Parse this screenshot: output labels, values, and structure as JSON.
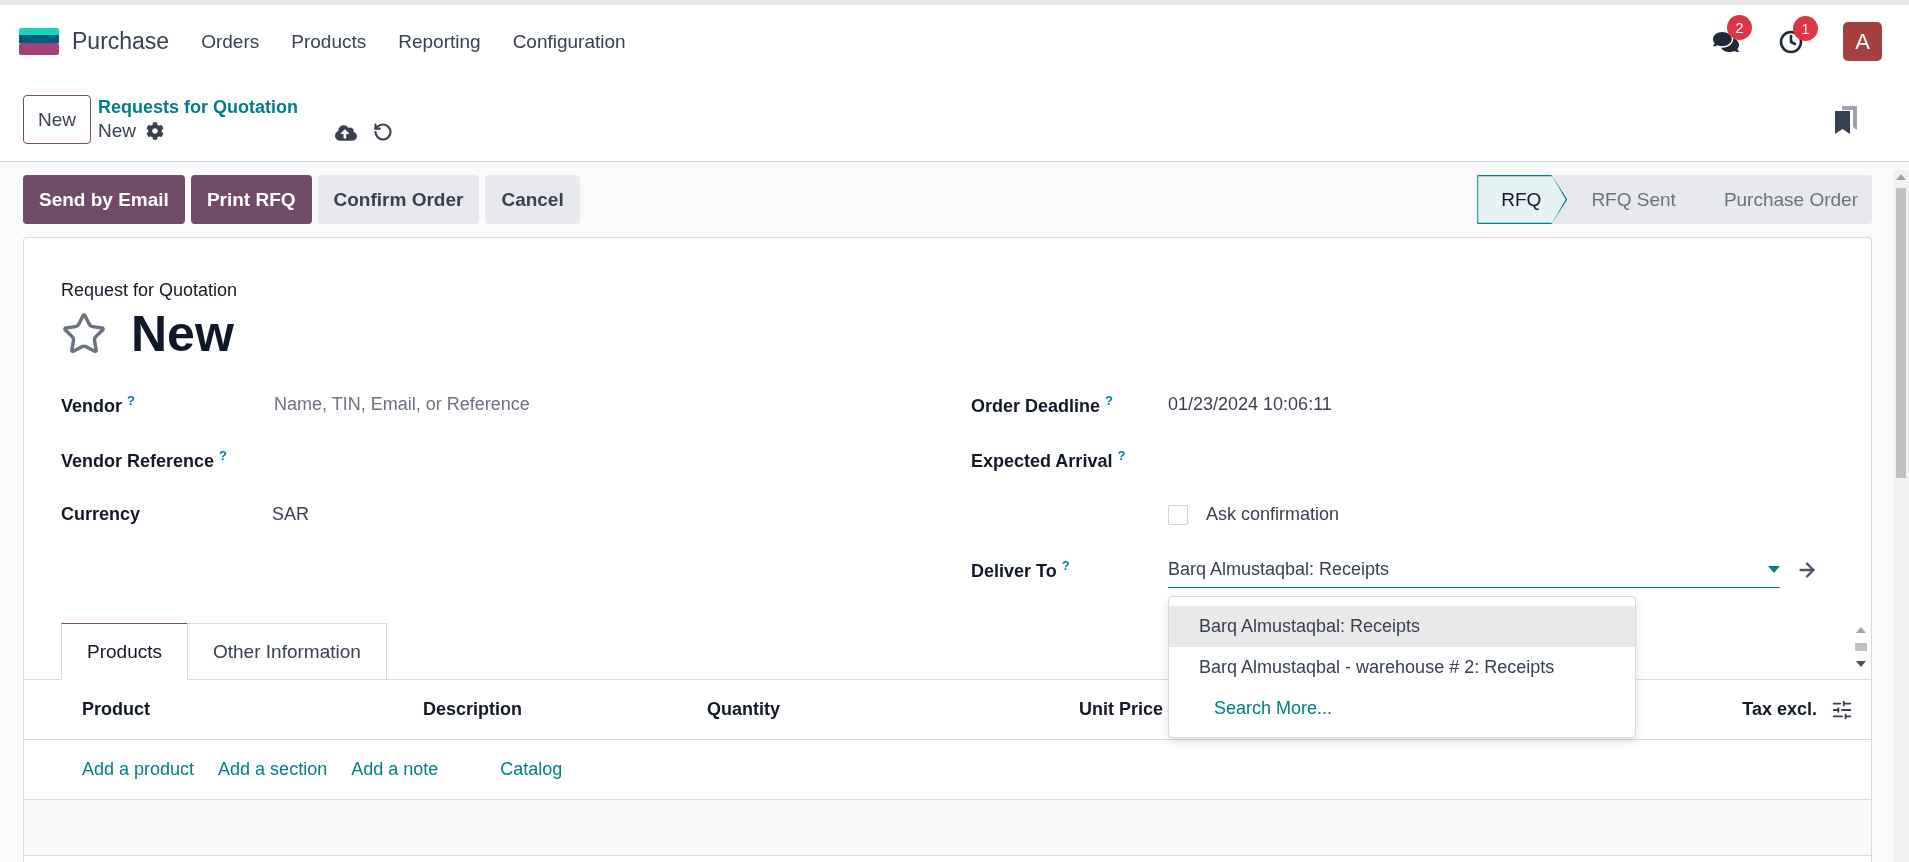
{
  "app": {
    "name": "Purchase",
    "menu": [
      "Orders",
      "Products",
      "Reporting",
      "Configuration"
    ]
  },
  "systray": [
    {
      "kind": "chat",
      "badge": "2"
    },
    {
      "kind": "activity",
      "badge": "1"
    }
  ],
  "avatar": "A",
  "control_panel": {
    "new_button": "New",
    "breadcrumb": "Requests for Quotation",
    "current": "New"
  },
  "actions": [
    {
      "label": "Send by Email",
      "primary": true
    },
    {
      "label": "Print RFQ",
      "primary": true
    },
    {
      "label": "Confirm Order",
      "primary": false
    },
    {
      "label": "Cancel",
      "primary": false
    }
  ],
  "statusbar": [
    {
      "label": "RFQ",
      "selected": true
    },
    {
      "label": "RFQ Sent",
      "selected": false
    },
    {
      "label": "Purchase Order",
      "selected": false
    }
  ],
  "form": {
    "subtitle": "Request for Quotation",
    "title": "New",
    "starred": false,
    "left_fields": [
      {
        "label": "Vendor",
        "help": "?",
        "placeholder": "Name, TIN, Email, or Reference"
      },
      {
        "label": "Vendor Reference",
        "help": "?"
      },
      {
        "label": "Currency",
        "value": "SAR"
      }
    ],
    "right_fields": [
      {
        "kind": "text",
        "label": "Order Deadline",
        "help": "?",
        "value": "01/23/2024 10:06:11"
      },
      {
        "kind": "text",
        "label": "Expected Arrival",
        "help": "?"
      },
      {
        "kind": "checkbox",
        "label": "Ask confirmation",
        "checked": false
      },
      {
        "kind": "select",
        "label": "Deliver To",
        "help": "?",
        "value": "Barq Almustaqbal: Receipts"
      }
    ]
  },
  "dropdown": {
    "options": [
      {
        "label": "Barq Almustaqbal: Receipts",
        "selected": true
      },
      {
        "label": "Barq Almustaqbal - warehouse # 2: Receipts",
        "selected": false
      }
    ],
    "search_more": "Search More..."
  },
  "tabs": [
    {
      "label": "Products",
      "selected": true
    },
    {
      "label": "Other Information",
      "selected": false
    }
  ],
  "table": {
    "columns": [
      "Product",
      "Description",
      "Quantity",
      "Unit Price",
      "Tax excl."
    ],
    "add_links": [
      "Add a product",
      "Add a section",
      "Add a note",
      "Catalog"
    ]
  }
}
